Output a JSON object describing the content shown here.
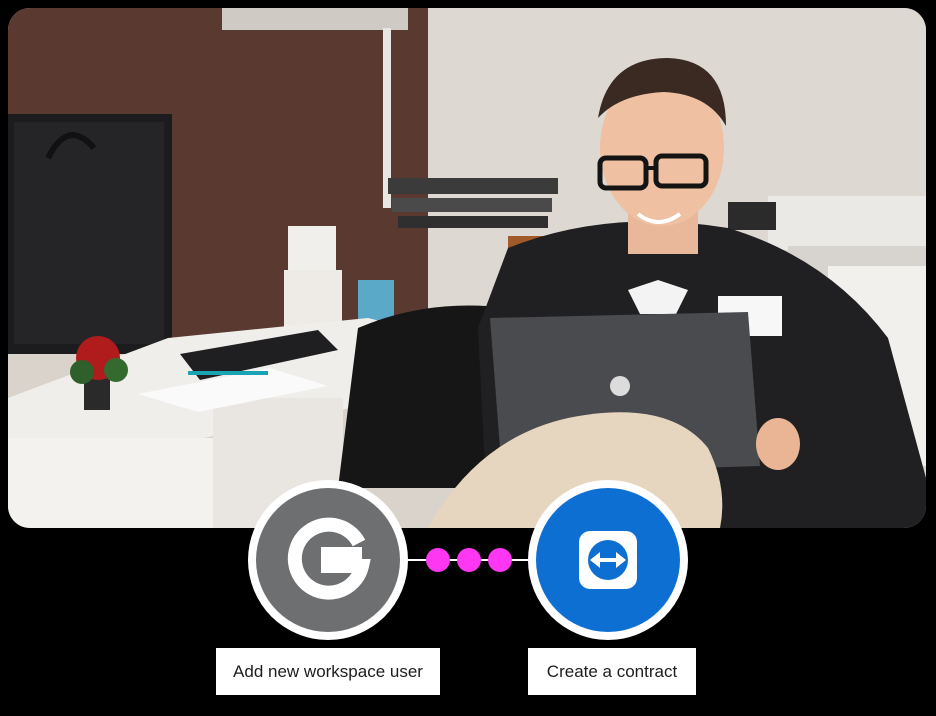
{
  "hero": {
    "image_icon": "office-photo-man-with-laptop"
  },
  "steps": [
    {
      "app_icon": "google-icon",
      "brand_color": "#6e6f71",
      "label": "Add new workspace user"
    },
    {
      "app_icon": "teamviewer-icon",
      "brand_color": "#0e6fd2",
      "label": "Create a contract"
    }
  ],
  "connector": {
    "dot_color": "#ff37f3",
    "dot_count": 3
  }
}
